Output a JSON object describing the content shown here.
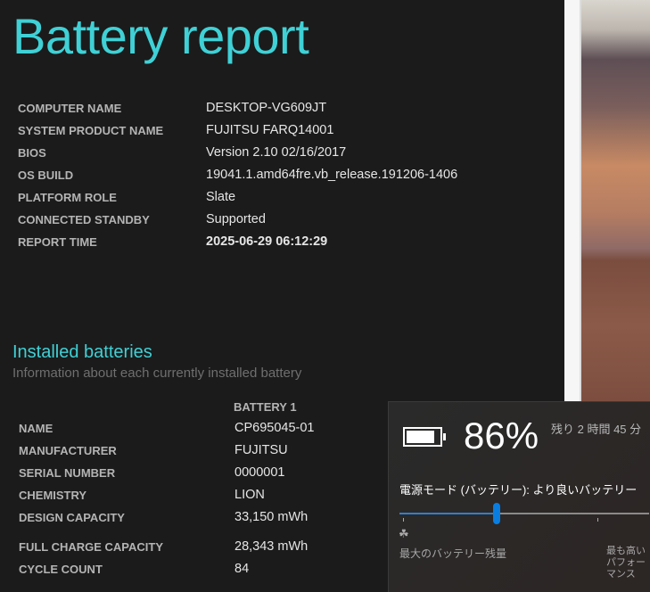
{
  "title": "Battery report",
  "system": [
    {
      "label": "COMPUTER NAME",
      "value": "DESKTOP-VG609JT"
    },
    {
      "label": "SYSTEM PRODUCT NAME",
      "value": "FUJITSU FARQ14001"
    },
    {
      "label": "BIOS",
      "value": "Version 2.10 02/16/2017"
    },
    {
      "label": "OS BUILD",
      "value": "19041.1.amd64fre.vb_release.191206-1406"
    },
    {
      "label": "PLATFORM ROLE",
      "value": "Slate"
    },
    {
      "label": "CONNECTED STANDBY",
      "value": "Supported"
    },
    {
      "label": "REPORT TIME",
      "value": "2025-06-29  06:12:29"
    }
  ],
  "installed": {
    "heading": "Installed batteries",
    "subtitle": "Information about each currently installed battery",
    "column": "BATTERY 1",
    "rows": [
      {
        "label": "NAME",
        "value": "CP695045-01"
      },
      {
        "label": "MANUFACTURER",
        "value": "FUJITSU"
      },
      {
        "label": "SERIAL NUMBER",
        "value": "0000001"
      },
      {
        "label": "CHEMISTRY",
        "value": "LION"
      },
      {
        "label": "DESIGN CAPACITY",
        "value": "33,150 mWh"
      },
      {
        "label": "FULL CHARGE CAPACITY",
        "value": "28,343 mWh"
      },
      {
        "label": "CYCLE COUNT",
        "value": "84"
      }
    ]
  },
  "flyout": {
    "percent": "86%",
    "percent_value": 86,
    "remaining": "残り 2 時間 45 分",
    "mode": "電源モード (バッテリー): より良いバッテリー",
    "slider_fraction": 0.39,
    "left_label": "最大のバッテリー残量",
    "right_label": "最も高いパフォーマンス",
    "accent": "#0a7ee0"
  }
}
